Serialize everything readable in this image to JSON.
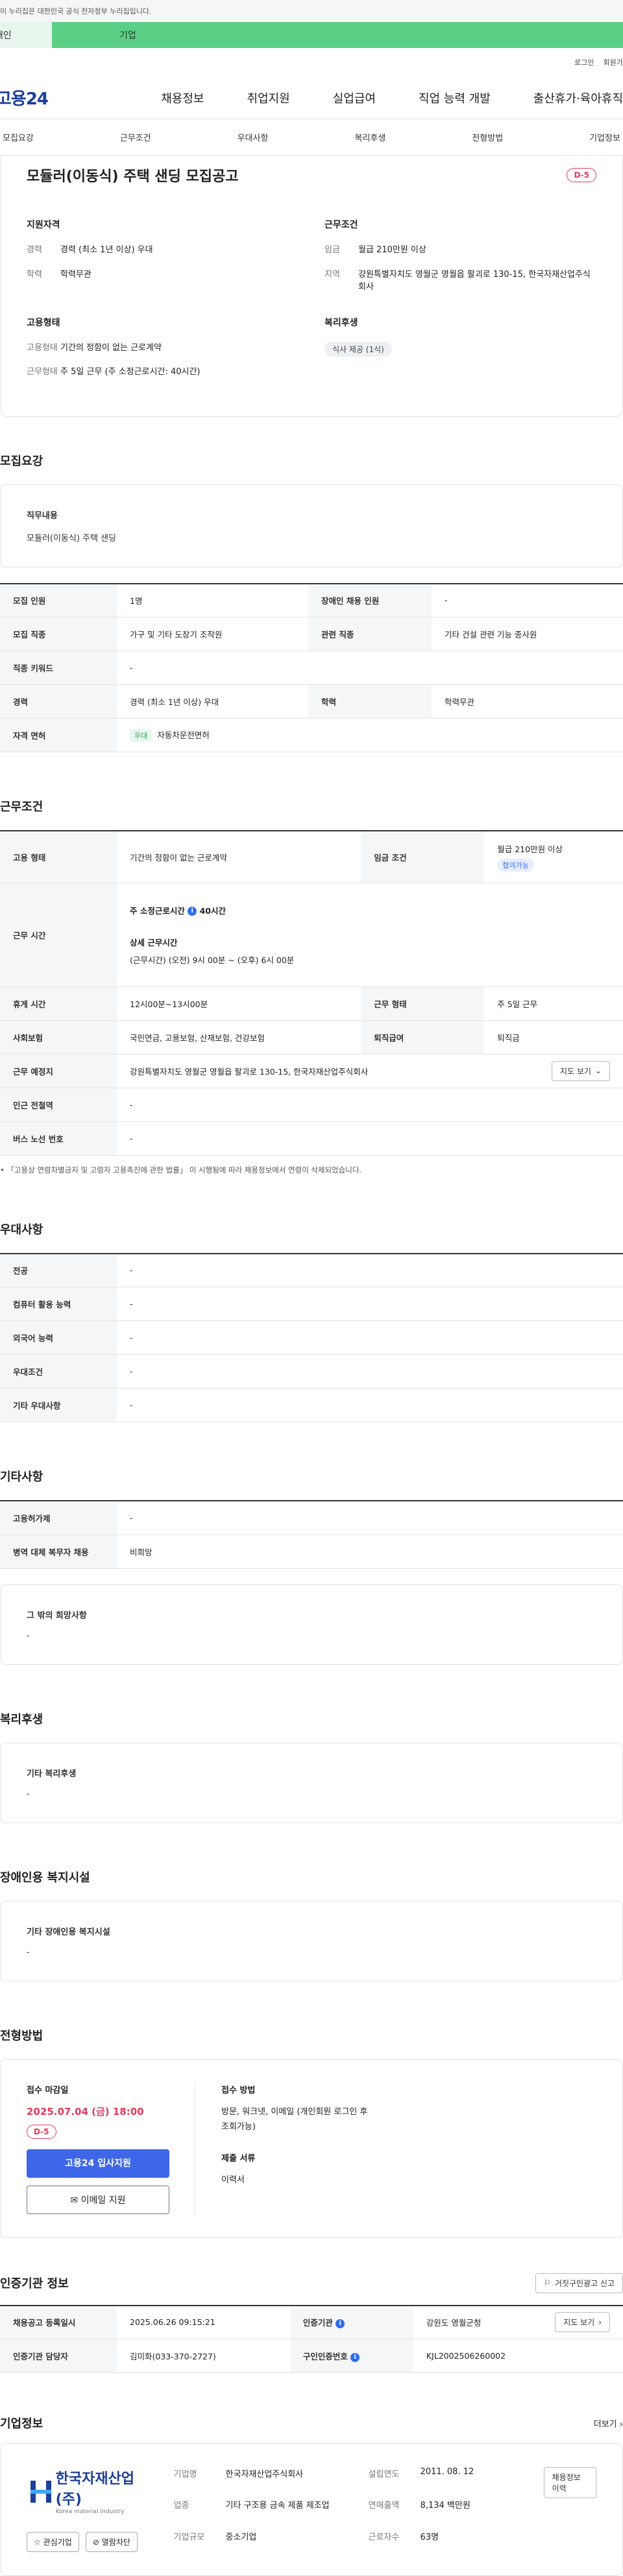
{
  "gov_banner": "이 누리집은 대한민국 공식 전자정부 누리집입니다.",
  "top_tabs": [
    "개인",
    "기업"
  ],
  "util_links": [
    "로그인",
    "회원가입"
  ],
  "logo": "고용24",
  "gnb_menu": [
    "채용정보",
    "취업지원",
    "실업급여",
    "직업 능력 개발",
    "출산휴가·육아휴직"
  ],
  "subnav": [
    "모집요강",
    "근무조건",
    "우대사항",
    "복리후생",
    "전형방법",
    "기업정보"
  ],
  "hero": {
    "title": "모듈러(이동식) 주택 샌딩 모집공고",
    "dday": "D-5",
    "qual_title": "지원자격",
    "qual": [
      {
        "k": "경력",
        "v": "경력 (최소 1년 이상) 우대"
      },
      {
        "k": "학력",
        "v": "학력무관"
      }
    ],
    "work_title": "근무조건",
    "work": [
      {
        "k": "임금",
        "v": "월급 210만원 이상"
      },
      {
        "k": "지역",
        "v": "강원특별자치도 영월군 영월읍 팔괴로 130-15, 한국자재산업주식회사"
      }
    ],
    "emp_title": "고용형태",
    "emp": [
      {
        "k": "고용형태",
        "v": "기간의 정함이 없는 근로계약"
      },
      {
        "k": "근무형태",
        "v": "주 5일 근무 (주 소정근로시간: 40시간)"
      }
    ],
    "welfare_title": "복리후생",
    "welfare_chip": "식사 제공 (1식)"
  },
  "recruit": {
    "title": "모집요강",
    "job_label": "직무내용",
    "job_value": "모듈러(이동식) 주택 샌딩",
    "rows": [
      [
        "모집 인원",
        "1명",
        "장애인 채용 인원",
        "-"
      ],
      [
        "모집 직종",
        "가구 및 기타 도장기 조작원",
        "관련 직종",
        "기타 건설 관련 기능 종사원"
      ],
      [
        "직종 키워드",
        "-"
      ],
      [
        "경력",
        "경력 (최소 1년 이상) 우대",
        "학력",
        "학력무관"
      ]
    ],
    "license_label": "자격 면허",
    "license_tag": "우대",
    "license_value": "자동차운전면허"
  },
  "work": {
    "title": "근무조건",
    "emp_type_label": "고용 형태",
    "emp_type": "기간의 정함이 없는 근로계약",
    "wage_label": "임금 조건",
    "wage": "월급 210만원 이상",
    "wage_chip": "협의가능",
    "hours_label": "근무 시간",
    "hours_weekly": "주 소정근로시간",
    "hours_weekly_value": "40시간",
    "hours_detail_title": "상세 근무시간",
    "hours_detail": "(근무시간) (오전) 9시 00분 ~ (오후) 6시 00분",
    "break_label": "휴게 시간",
    "break": "12시00분~13시00분",
    "work_form_label": "근무 형태",
    "work_form": "주 5일 근무",
    "insurance_label": "사회보험",
    "insurance": "국민연금, 고용보험, 산재보험, 건강보험",
    "severance_label": "퇴직급여",
    "severance": "퇴직금",
    "place_label": "근무 예정지",
    "place": "강원특별자치도 영월군 영월읍 팔괴로 130-15, 한국자재산업주식회사",
    "map_btn": "지도 보기",
    "subway_label": "인근 전철역",
    "subway": "-",
    "bus_label": "버스 노선 번호",
    "bus": "-",
    "note": "「고용상 연령차별금지 및 고령자 고용촉진에 관한 법률」 이 시행됨에 따라 채용정보에서 연령이 삭제되었습니다."
  },
  "pref": {
    "title": "우대사항",
    "rows": [
      [
        "전공",
        "-"
      ],
      [
        "컴퓨터 활용 능력",
        "-"
      ],
      [
        "외국어 능력",
        "-"
      ],
      [
        "우대조건",
        "-"
      ],
      [
        "기타 우대사항",
        "-"
      ]
    ]
  },
  "etc": {
    "title": "기타사항",
    "rows": [
      [
        "고용허가제",
        "-"
      ],
      [
        "병역 대체 복무자 채용",
        "비희망"
      ]
    ],
    "card_label": "그 밖의 희망사항",
    "card_value": "-"
  },
  "benefits": {
    "title": "복리후생",
    "label": "기타 복리후생",
    "value": "-"
  },
  "disability": {
    "title": "장애인용 복지시설",
    "label": "기타 장애인용 복지시설",
    "value": "-"
  },
  "process": {
    "title": "전형방법",
    "deadline_label": "접수 마감일",
    "deadline": "2025.07.04 (금) 18:00",
    "dday": "D-5",
    "apply_btn": "고용24 입사지원",
    "email_btn": "이메일 지원",
    "method_label": "접수 방법",
    "method": "방문, 워크넷, 이메일 (개인회원 로그인 후 조회가능)",
    "docs_label": "제출 서류",
    "docs": "이력서"
  },
  "cert": {
    "title": "인증기관 정보",
    "report_btn": "거짓구인광고 신고",
    "rows": [
      [
        "채용공고 등록일시",
        "2025.06.26 09:15:21",
        "인증기관",
        "강원도 영월군청"
      ],
      [
        "인증기관 담당자",
        "김미화(033-370-2727)",
        "구인인증번호",
        "KJL2002506260002"
      ]
    ],
    "map_btn": "지도 보기"
  },
  "company": {
    "title": "기업정보",
    "more": "더보기",
    "name_logo": "한국자재산업(주)",
    "name_en": "Korea material Industry",
    "fav_btn": "관심기업",
    "block_btn": "열람차단",
    "fields": [
      [
        "기업명",
        "한국자재산업주식회사",
        "설립연도",
        "2011. 08. 12"
      ],
      [
        "업종",
        "기타 구조용 금속 제품 제조업",
        "연매출액",
        "8,134 백만원"
      ],
      [
        "기업규모",
        "중소기업",
        "근로자수",
        "63명"
      ]
    ],
    "history_btn": "채용정보 이력"
  }
}
